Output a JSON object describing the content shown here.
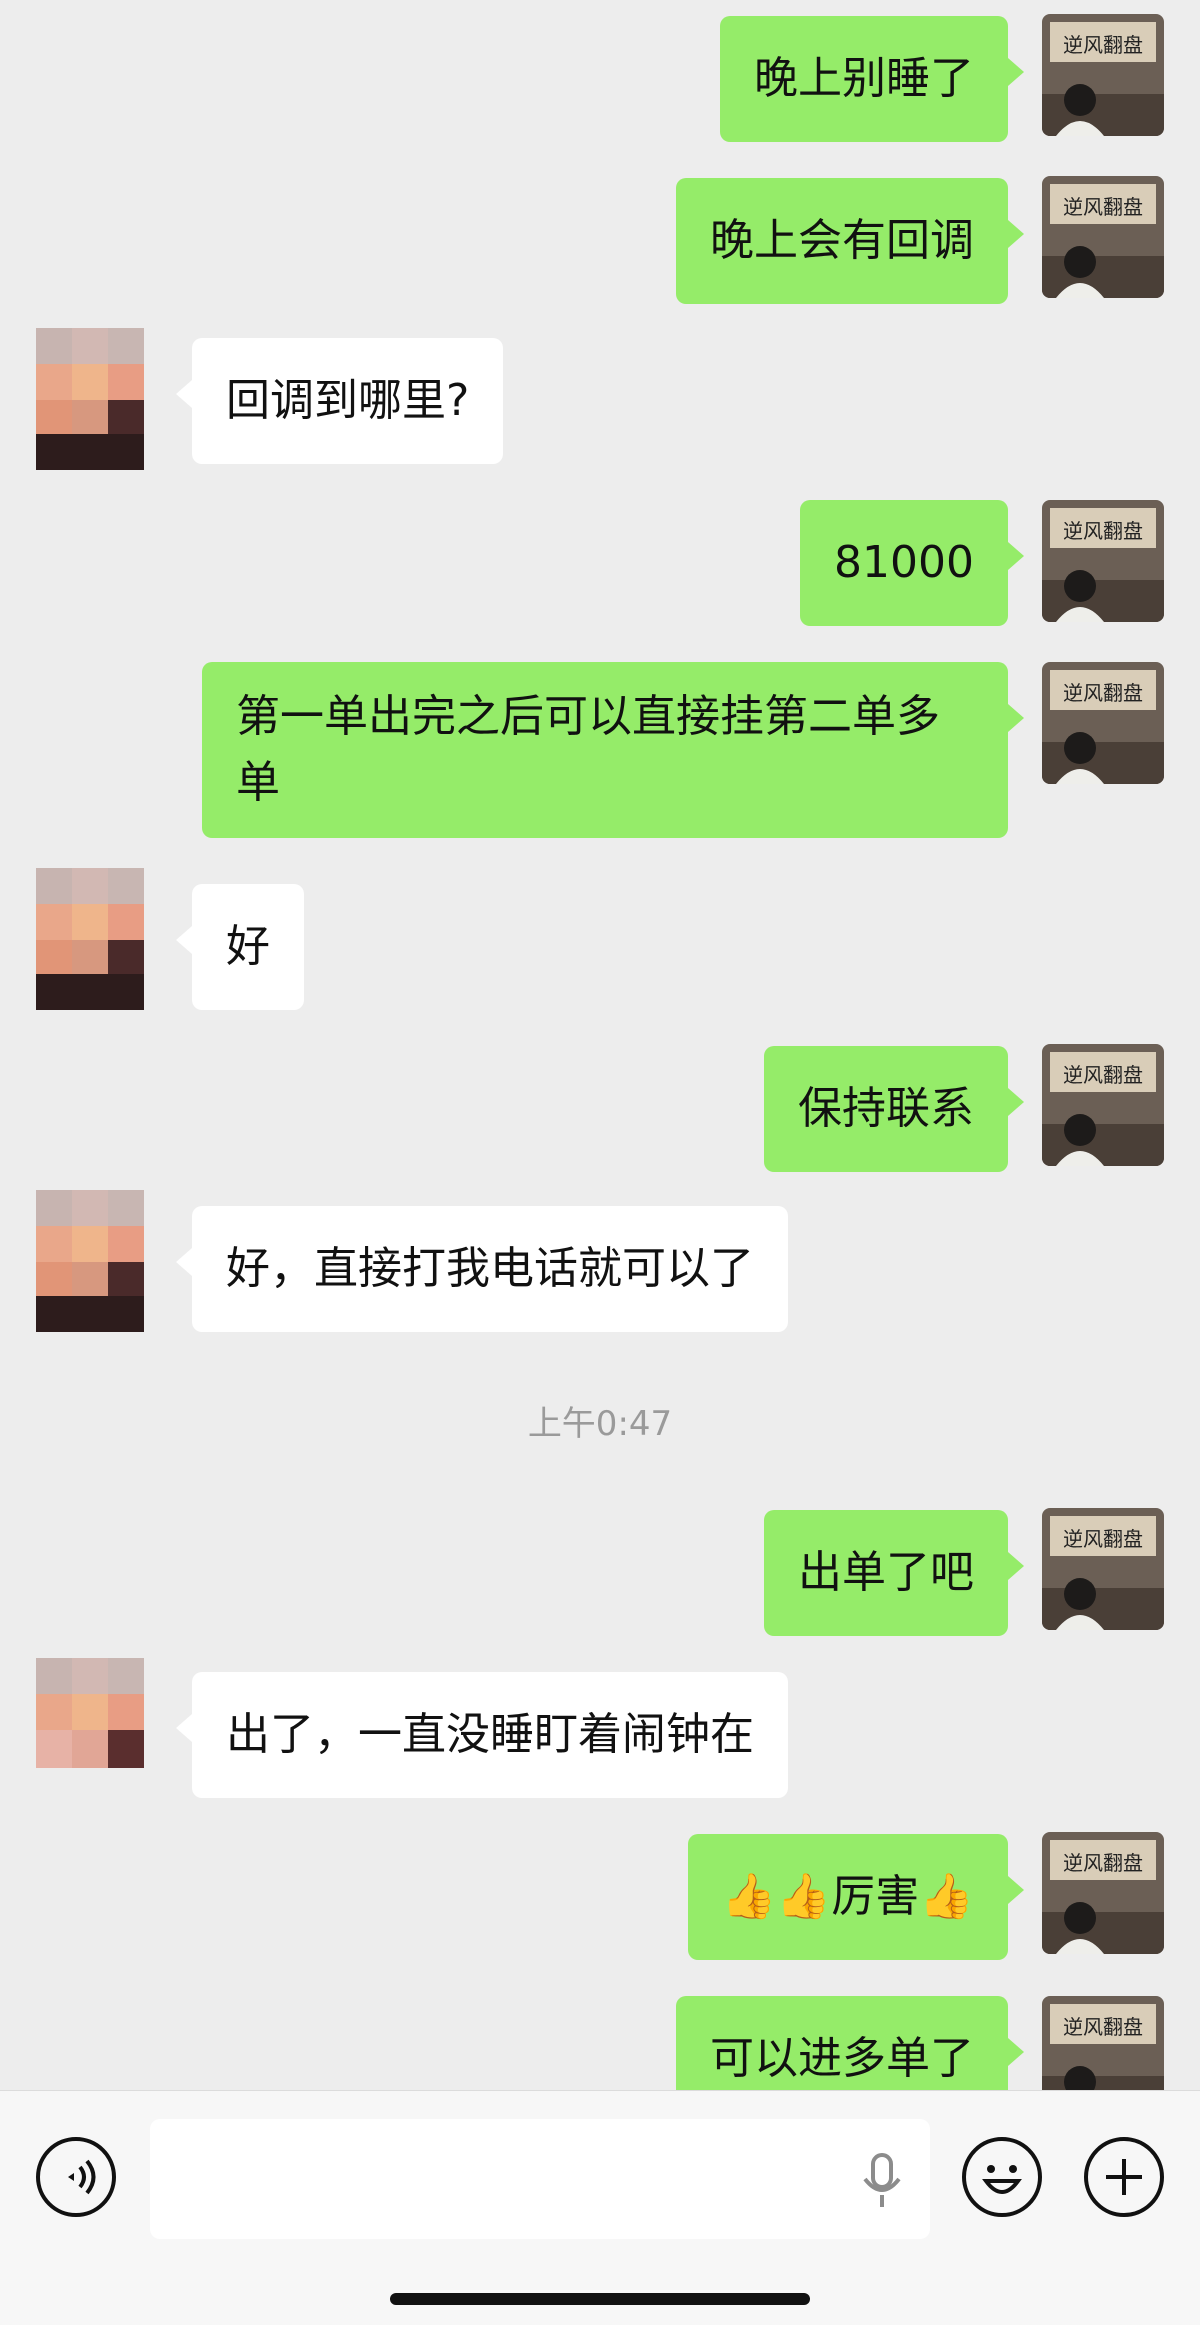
{
  "conversation": {
    "messages": [
      {
        "from": "me",
        "text": "晚上别睡了"
      },
      {
        "from": "me",
        "text": "晚上会有回调"
      },
      {
        "from": "contact",
        "text": "回调到哪里?"
      },
      {
        "from": "me",
        "text": "81000"
      },
      {
        "from": "me",
        "text": "第一单出完之后可以直接挂第二单多单"
      },
      {
        "from": "contact",
        "text": "好"
      },
      {
        "from": "me",
        "text": "保持联系"
      },
      {
        "from": "contact",
        "text": "好，直接打我电话就可以了"
      },
      {
        "from": "me",
        "text": "出单了吧"
      },
      {
        "from": "contact",
        "text": "出了，一直没睡盯着闹钟在"
      },
      {
        "from": "me",
        "text": "👍👍厉害👍"
      },
      {
        "from": "me",
        "text": "可以进多单了"
      }
    ],
    "timestamp": "上午0:47"
  },
  "my_avatar": {
    "plaque_text": "逆风翻盘"
  },
  "colors": {
    "outgoing": "#95ec69",
    "incoming": "#ffffff",
    "background": "#ededed"
  },
  "input_bar": {
    "voice_icon": "voice-toggle-icon",
    "mic_icon": "microphone-icon",
    "emoji_icon": "emoji-icon",
    "plus_icon": "plus-icon",
    "text_value": ""
  }
}
